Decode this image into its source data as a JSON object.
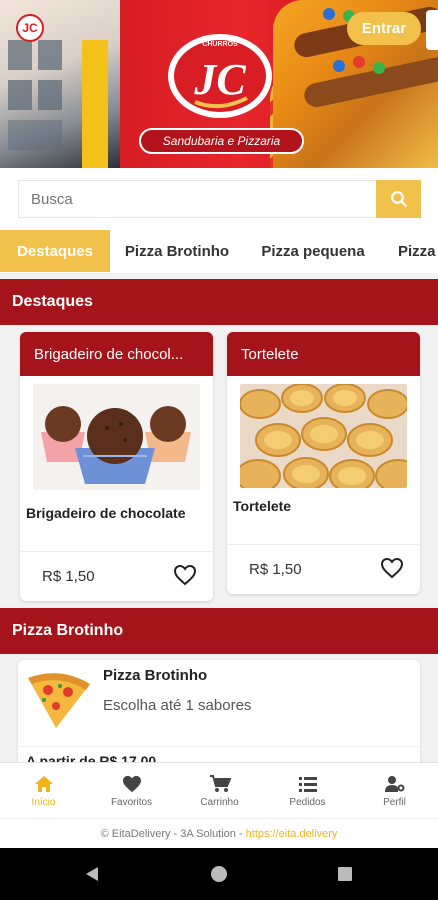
{
  "header": {
    "small_logo_text": "JC",
    "logo_text": "JC",
    "logo_top_text": "CHURROS",
    "tagline": "Sandubaria e Pizzaria",
    "login_label": "Entrar",
    "brand_color": "#d81d24",
    "accent_color": "#f2c14b"
  },
  "search": {
    "placeholder": "Busca",
    "icon": "search-icon"
  },
  "tabs": [
    "Destaques",
    "Pizza Brotinho",
    "Pizza pequena",
    "Pizza"
  ],
  "sections": {
    "destaques_title": "Destaques",
    "brotinho_title": "Pizza Brotinho"
  },
  "cards": [
    {
      "title": "Brigadeiro de chocol...",
      "name": "Brigadeiro de chocolate",
      "price": "R$ 1,50"
    },
    {
      "title": "Tortelete",
      "name": "Tortelete",
      "price": "R$ 1,50"
    }
  ],
  "item": {
    "name": "Pizza Brotinho",
    "description": "Escolha até 1 sabores",
    "price": "A partir de R$ 17,00"
  },
  "bottom_nav": [
    {
      "label": "Início",
      "icon": "home-icon"
    },
    {
      "label": "Favoritos",
      "icon": "heart-icon"
    },
    {
      "label": "Carrinho",
      "icon": "cart-icon"
    },
    {
      "label": "Pedidos",
      "icon": "list-icon"
    },
    {
      "label": "Perfil",
      "icon": "user-gear-icon"
    }
  ],
  "footer": {
    "text": "© EitaDelivery - 3A Solution -",
    "link": "https://eita.delivery"
  }
}
